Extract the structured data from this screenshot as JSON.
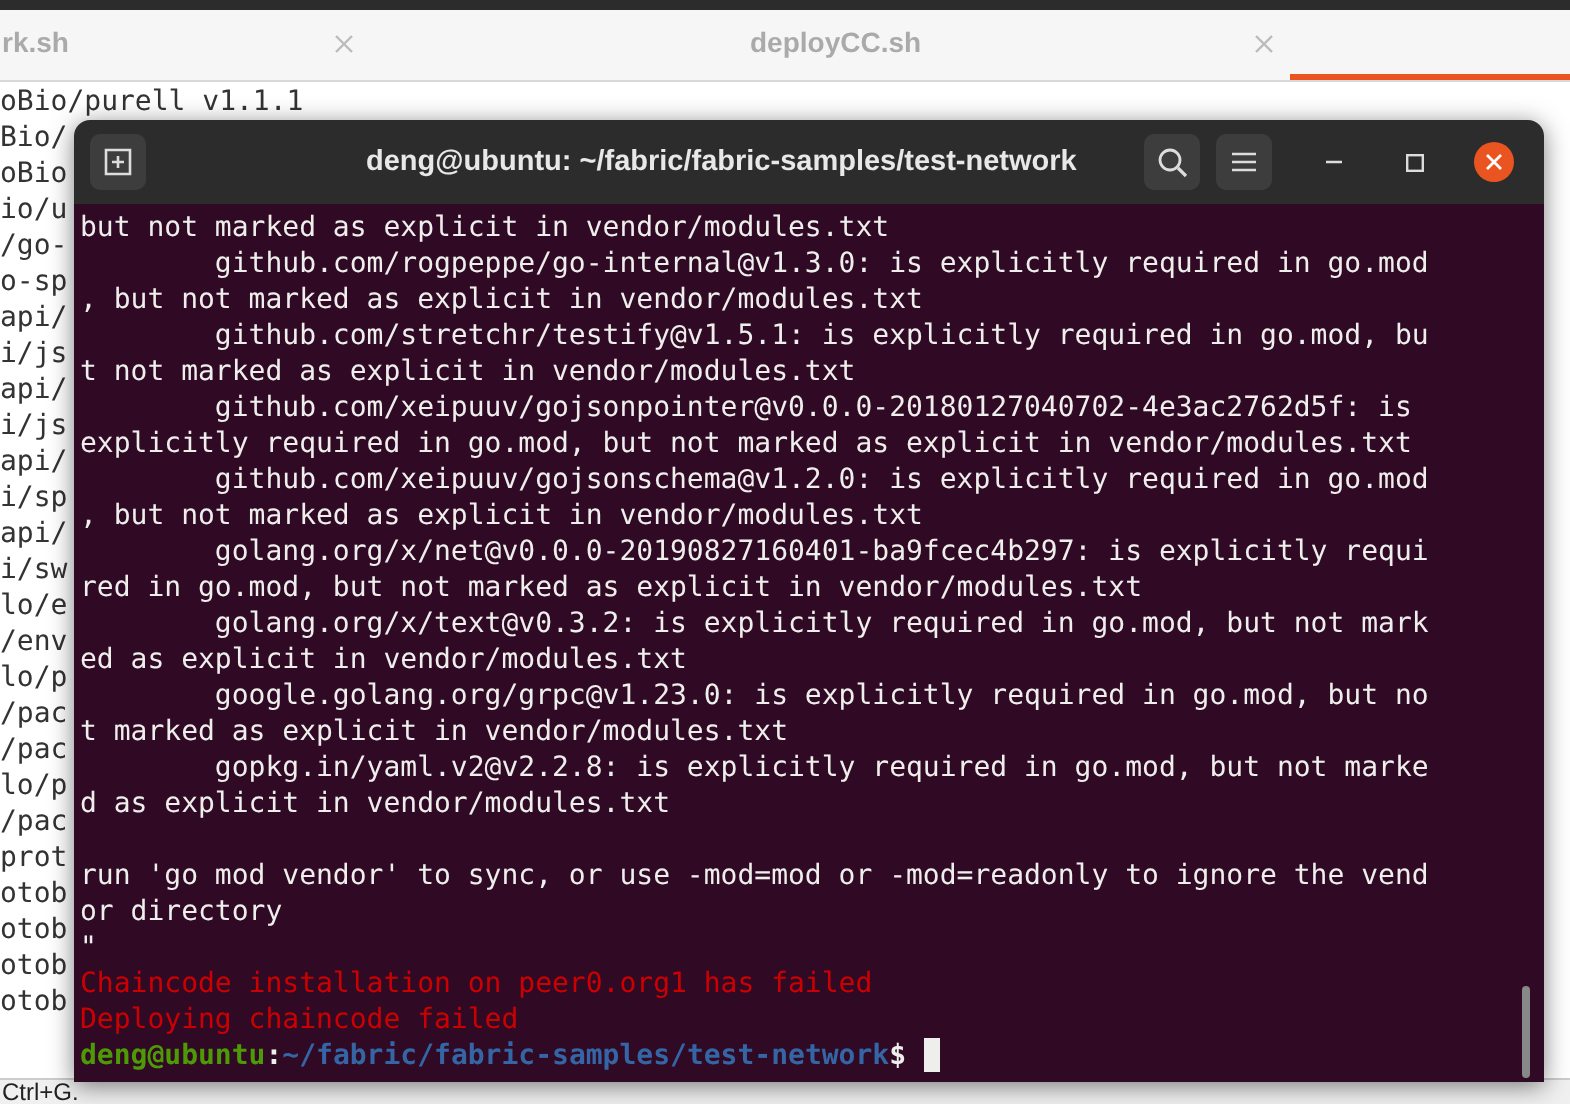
{
  "editor": {
    "tabs": [
      {
        "label": "rk.sh",
        "selected": false
      },
      {
        "label": "deployCC.sh",
        "selected": false
      },
      {
        "selected": true
      }
    ],
    "lines": [
      "oBio/purell v1.1.1",
      "Bio/",
      "oBio",
      "io/u",
      "/go-",
      "o-sp",
      "api/",
      "i/js",
      "api/",
      "i/js",
      "api/",
      "i/sp",
      "api/",
      "i/sw",
      "lo/e",
      "/env",
      "lo/p",
      "/pac",
      "/pac",
      "lo/p",
      "/pac",
      "prot",
      "otob",
      "otob",
      "otob",
      "otob"
    ],
    "status_bar": "Ctrl+G."
  },
  "terminal": {
    "title": "deng@ubuntu: ~/fabric/fabric-samples/test-network",
    "lines": [
      {
        "kind": "normal",
        "text": "but not marked as explicit in vendor/modules.txt"
      },
      {
        "kind": "normal",
        "text": "        github.com/rogpeppe/go-internal@v1.3.0: is explicitly required in go.mod"
      },
      {
        "kind": "normal",
        "text": ", but not marked as explicit in vendor/modules.txt"
      },
      {
        "kind": "normal",
        "text": "        github.com/stretchr/testify@v1.5.1: is explicitly required in go.mod, bu"
      },
      {
        "kind": "normal",
        "text": "t not marked as explicit in vendor/modules.txt"
      },
      {
        "kind": "normal",
        "text": "        github.com/xeipuuv/gojsonpointer@v0.0.0-20180127040702-4e3ac2762d5f: is"
      },
      {
        "kind": "normal",
        "text": "explicitly required in go.mod, but not marked as explicit in vendor/modules.txt"
      },
      {
        "kind": "normal",
        "text": "        github.com/xeipuuv/gojsonschema@v1.2.0: is explicitly required in go.mod"
      },
      {
        "kind": "normal",
        "text": ", but not marked as explicit in vendor/modules.txt"
      },
      {
        "kind": "normal",
        "text": "        golang.org/x/net@v0.0.0-20190827160401-ba9fcec4b297: is explicitly requi"
      },
      {
        "kind": "normal",
        "text": "red in go.mod, but not marked as explicit in vendor/modules.txt"
      },
      {
        "kind": "normal",
        "text": "        golang.org/x/text@v0.3.2: is explicitly required in go.mod, but not mark"
      },
      {
        "kind": "normal",
        "text": "ed as explicit in vendor/modules.txt"
      },
      {
        "kind": "normal",
        "text": "        google.golang.org/grpc@v1.23.0: is explicitly required in go.mod, but no"
      },
      {
        "kind": "normal",
        "text": "t marked as explicit in vendor/modules.txt"
      },
      {
        "kind": "normal",
        "text": "        gopkg.in/yaml.v2@v2.2.8: is explicitly required in go.mod, but not marke"
      },
      {
        "kind": "normal",
        "text": "d as explicit in vendor/modules.txt"
      },
      {
        "kind": "blank"
      },
      {
        "kind": "normal",
        "text": "run 'go mod vendor' to sync, or use -mod=mod or -mod=readonly to ignore the vend"
      },
      {
        "kind": "normal",
        "text": "or directory"
      },
      {
        "kind": "normal",
        "text": "\""
      },
      {
        "kind": "error",
        "text": "Chaincode installation on peer0.org1 has failed"
      },
      {
        "kind": "error",
        "text": "Deploying chaincode failed"
      },
      {
        "kind": "prompt",
        "user": "deng@ubuntu",
        "separator": ":",
        "path": "~/fabric/fabric-samples/test-network",
        "symbol": "$"
      }
    ]
  }
}
